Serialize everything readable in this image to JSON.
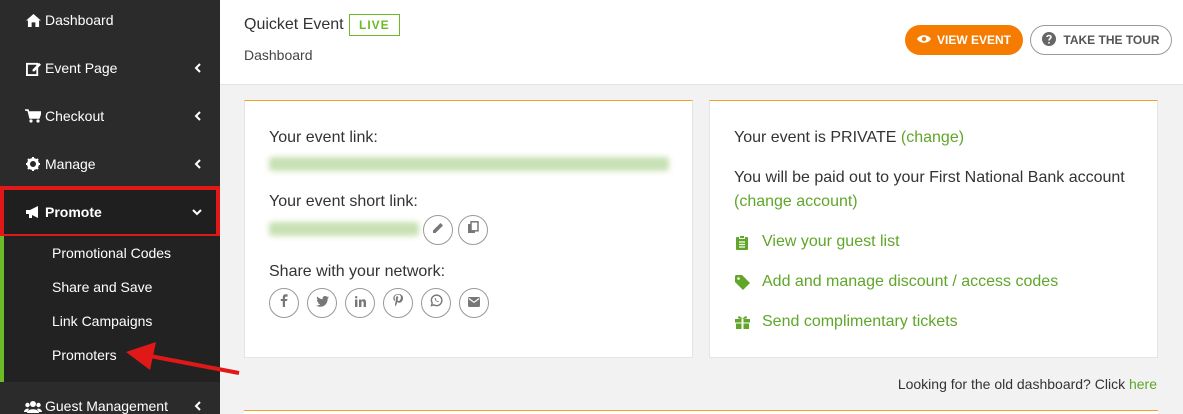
{
  "sidebar": {
    "items": [
      {
        "label": "Dashboard",
        "icon": "home-icon"
      },
      {
        "label": "Event Page",
        "icon": "edit-icon"
      },
      {
        "label": "Checkout",
        "icon": "cart-icon"
      },
      {
        "label": "Manage",
        "icon": "gear-icon"
      },
      {
        "label": "Promote",
        "icon": "megaphone-icon"
      },
      {
        "label": "Guest Management",
        "icon": "users-icon"
      }
    ],
    "promote_submenu": [
      "Promotional Codes",
      "Share and Save",
      "Link Campaigns",
      "Promoters"
    ]
  },
  "header": {
    "event_title": "Quicket Event",
    "status_badge": "LIVE",
    "breadcrumb": "Dashboard",
    "view_event_label": "VIEW EVENT",
    "take_tour_label": "TAKE THE TOUR"
  },
  "left_card": {
    "event_link_label": "Your event link:",
    "short_link_label": "Your event short link:",
    "share_label": "Share with your network:",
    "share_icons": [
      "facebook-icon",
      "twitter-icon",
      "linkedin-icon",
      "pinterest-icon",
      "whatsapp-icon",
      "email-icon"
    ]
  },
  "right_card": {
    "privacy_text": "Your event is PRIVATE",
    "privacy_change": "(change)",
    "payout_text": "You will be paid out to your First National Bank account",
    "payout_change": "(change account)",
    "links": [
      {
        "label": "View your guest list",
        "icon": "clipboard-icon"
      },
      {
        "label": "Add and manage discount / access codes",
        "icon": "tag-icon"
      },
      {
        "label": "Send complimentary tickets",
        "icon": "gift-icon"
      }
    ]
  },
  "footer": {
    "old_dashboard_text": "Looking for the old dashboard? Click",
    "old_dashboard_link": "here"
  },
  "colors": {
    "sidebar_bg": "#2b2b2b",
    "accent_green": "#6dba27",
    "accent_orange": "#f57c00",
    "highlight_red": "#e01818"
  }
}
